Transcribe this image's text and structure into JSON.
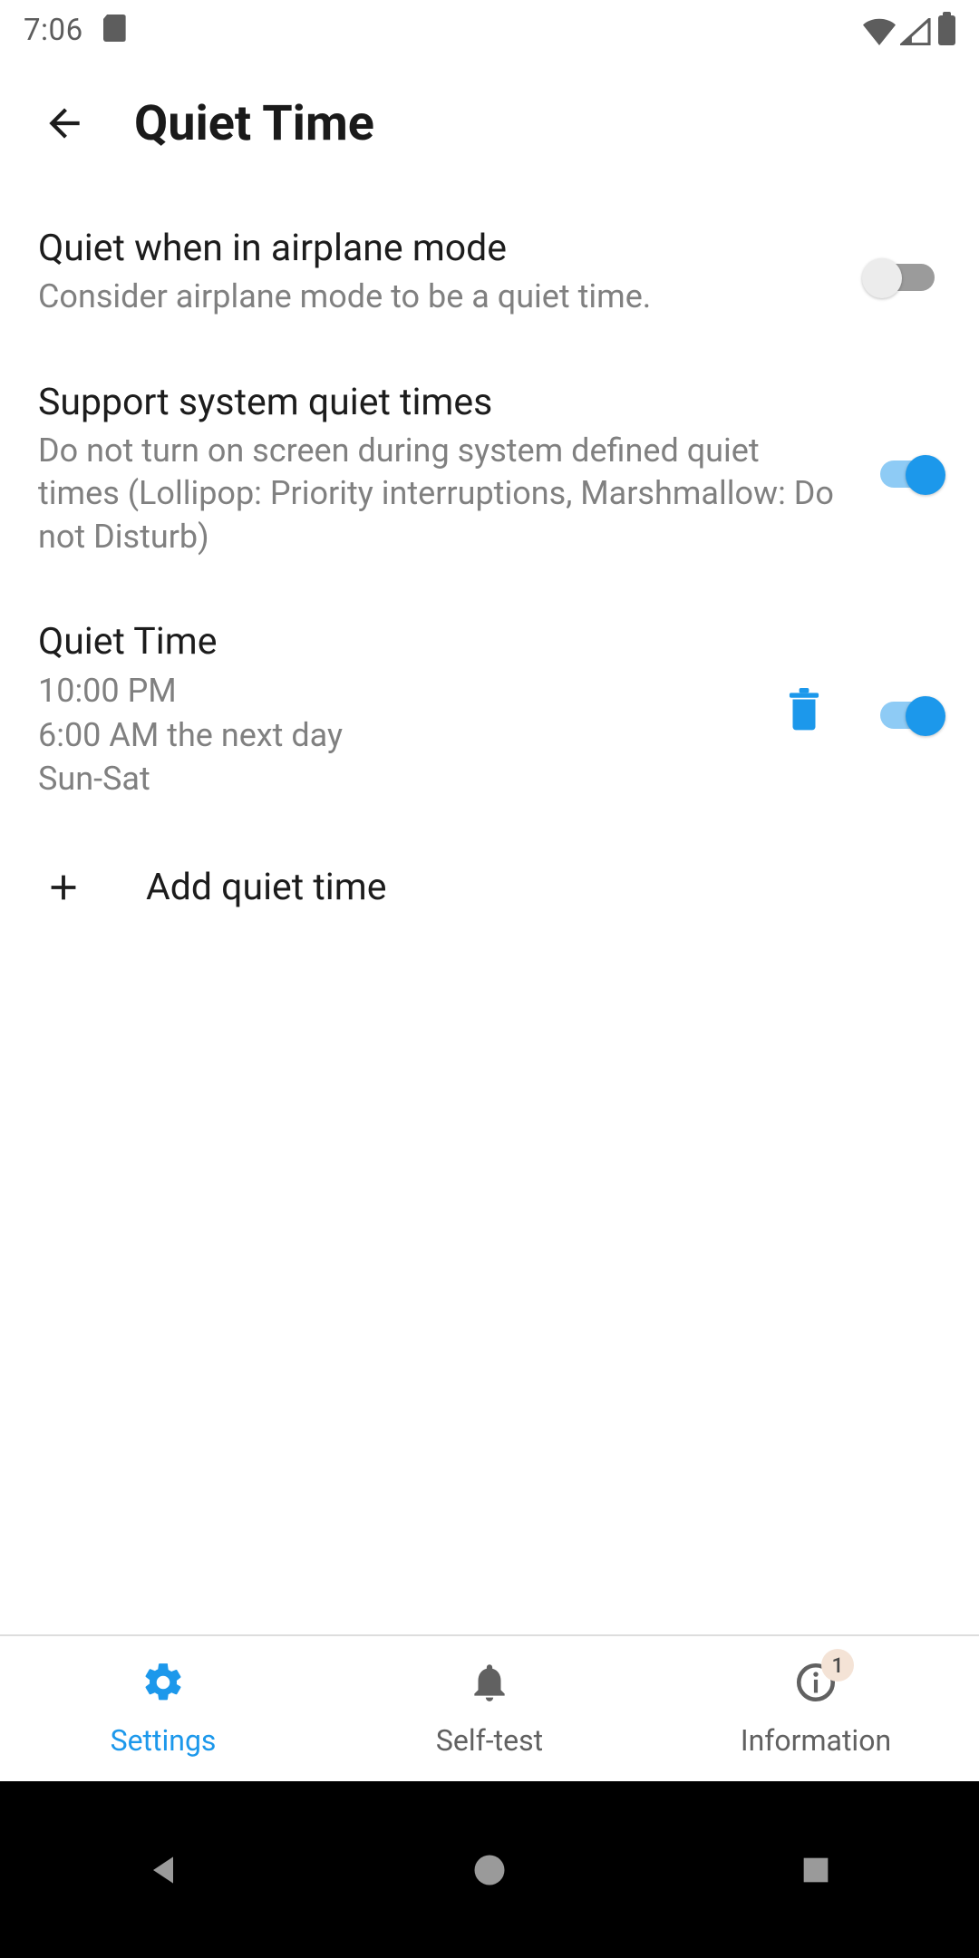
{
  "status": {
    "time": "7:06"
  },
  "header": {
    "title": "Quiet Time"
  },
  "settings": {
    "airplane": {
      "title": "Quiet when in airplane mode",
      "sub": "Consider airplane mode to be a quiet time.",
      "on": false
    },
    "system": {
      "title": "Support system quiet times",
      "sub": "Do not turn on screen during system defined quiet times (Lollipop: Priority interruptions, Marshmallow: Do not Disturb)",
      "on": true
    },
    "quiet_time": {
      "title": "Quiet Time",
      "start": "10:00 PM",
      "end": "6:00 AM the next day",
      "days": "Sun-Sat",
      "on": true
    },
    "add_label": "Add quiet time"
  },
  "tabs": {
    "settings": "Settings",
    "selftest": "Self-test",
    "information": "Information",
    "info_badge": "1"
  },
  "colors": {
    "accent": "#1c98eb"
  }
}
